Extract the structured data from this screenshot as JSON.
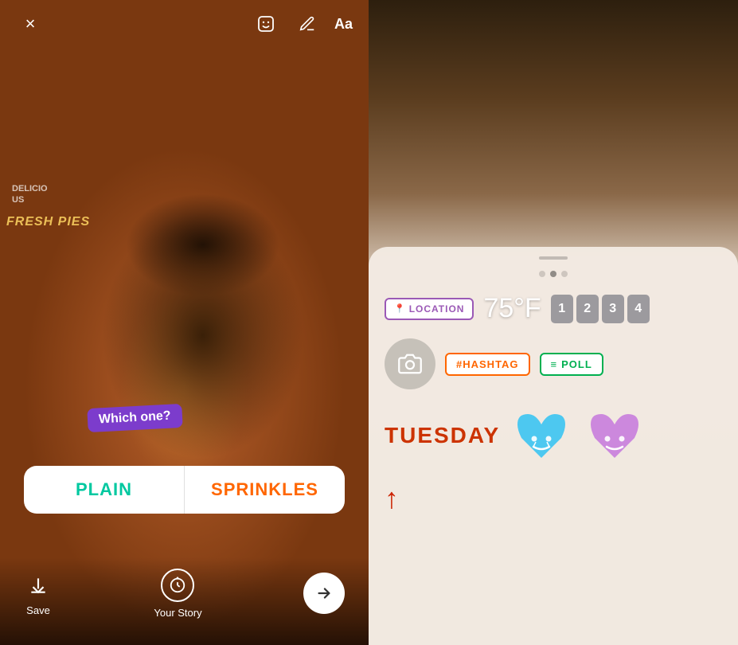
{
  "left_panel": {
    "close_label": "×",
    "top_icons": {
      "face_icon": "😊",
      "pencil_icon": "✏",
      "text_icon": "Aa"
    },
    "bakery": {
      "sign_line1": "DELICIO",
      "sign_line2": "US",
      "fresh_pies": "FRESH PIES"
    },
    "which_one_label": "Which one?",
    "poll": {
      "option1": "PLAIN",
      "option2": "SPRINKLES"
    },
    "bottom": {
      "save_icon": "↓",
      "save_label": "Save",
      "story_label": "Your Story",
      "next_icon": "→"
    }
  },
  "right_panel": {
    "sticker_picker": {
      "dots": [
        "inactive",
        "active",
        "inactive"
      ],
      "row1": {
        "location_pin": "📍",
        "location_label": "LOCATION",
        "temp_label": "75°F",
        "time_digits": [
          "1",
          "2",
          "3",
          "4"
        ]
      },
      "row2": {
        "camera_icon": "📷",
        "hashtag_label": "#HASHTAG",
        "poll_icon": "≡",
        "poll_label": "POLL"
      },
      "row3": {
        "day_label": "TUESDAY",
        "heart1_color": "blue",
        "heart2_color": "purple"
      }
    }
  }
}
